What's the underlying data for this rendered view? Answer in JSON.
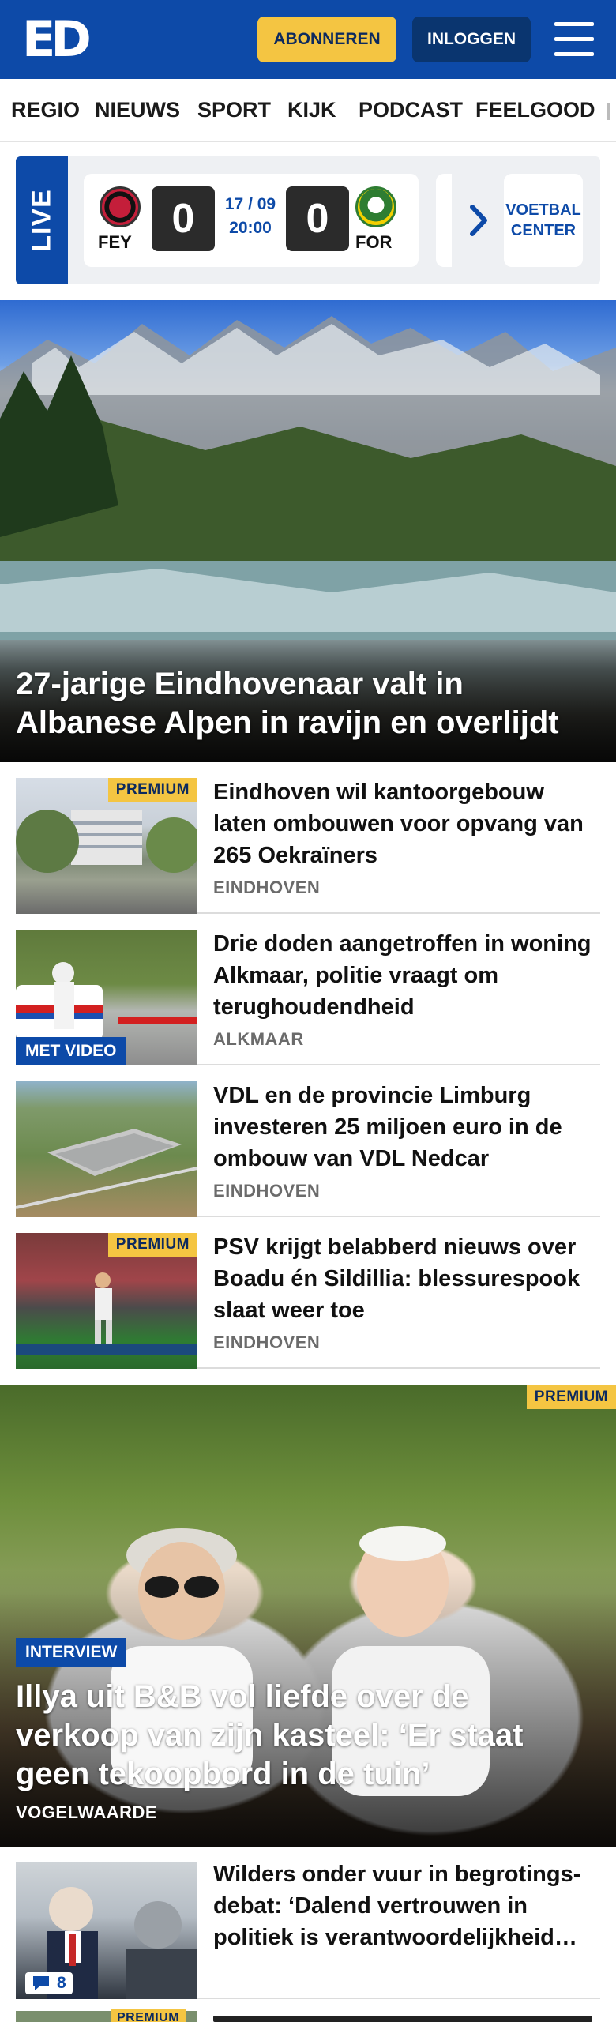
{
  "header": {
    "logo": "ED",
    "subscribe_label": "ABONNEREN",
    "login_label": "INLOGGEN",
    "menu_icon": "hamburger-icon",
    "colors": {
      "brand_blue": "#0d4aa8",
      "accent_yellow": "#f4c542"
    }
  },
  "nav": {
    "items": [
      {
        "label": "REGIO"
      },
      {
        "label": "NIEUWS"
      },
      {
        "label": "SPORT"
      },
      {
        "label": "KIJK"
      },
      {
        "label": "PODCAST"
      },
      {
        "label": "FEELGOOD"
      }
    ]
  },
  "live": {
    "tag": "LIVE",
    "match": {
      "home": "FEY",
      "home_score": "0",
      "away": "FOR",
      "away_score": "0",
      "date": "17 / 09",
      "time": "20:00"
    },
    "next_icon": "chevron-right-icon",
    "center_label": "VOETBAL CENTER"
  },
  "hero": {
    "title": "27-jarige Eindhovenaar valt in Albanese Alpen in ravijn en overlijdt"
  },
  "articles": [
    {
      "title": "Eindhoven wil kantoorgebouw laten ombouwen voor opvang van 265 Oekraïners",
      "place": "EINDHOVEN",
      "badge": "PREMIUM"
    },
    {
      "title": "Drie doden aangetroffen in woning Alkmaar, politie vraagt om terughoudendheid",
      "place": "ALKMAAR",
      "badge": "MET VIDEO"
    },
    {
      "title": "VDL en de provincie Limburg investeren 25 miljoen euro in de ombouw van VDL Nedcar",
      "place": "EINDHOVEN"
    },
    {
      "title": "PSV krijgt belabberd nieuws over Boadu én Sildillia: blessurespook slaat weer toe",
      "place": "EINDHOVEN",
      "badge": "PREMIUM"
    }
  ],
  "feature": {
    "badge": "PREMIUM",
    "tag": "INTERVIEW",
    "title": "Illya uit B&B vol liefde over de verkoop van zijn kasteel: ‘Er staat geen tekoopbord in de tuin’",
    "place": "VOGELWAARDE"
  },
  "article_bottom": {
    "title": "Wilders onder vuur in begrotings-debat: ‘Dalend vertrouwen in politiek is verantwoordelijkheid…",
    "comments": "8",
    "comment_icon": "comment-icon",
    "next_badge": "PREMIUM"
  }
}
